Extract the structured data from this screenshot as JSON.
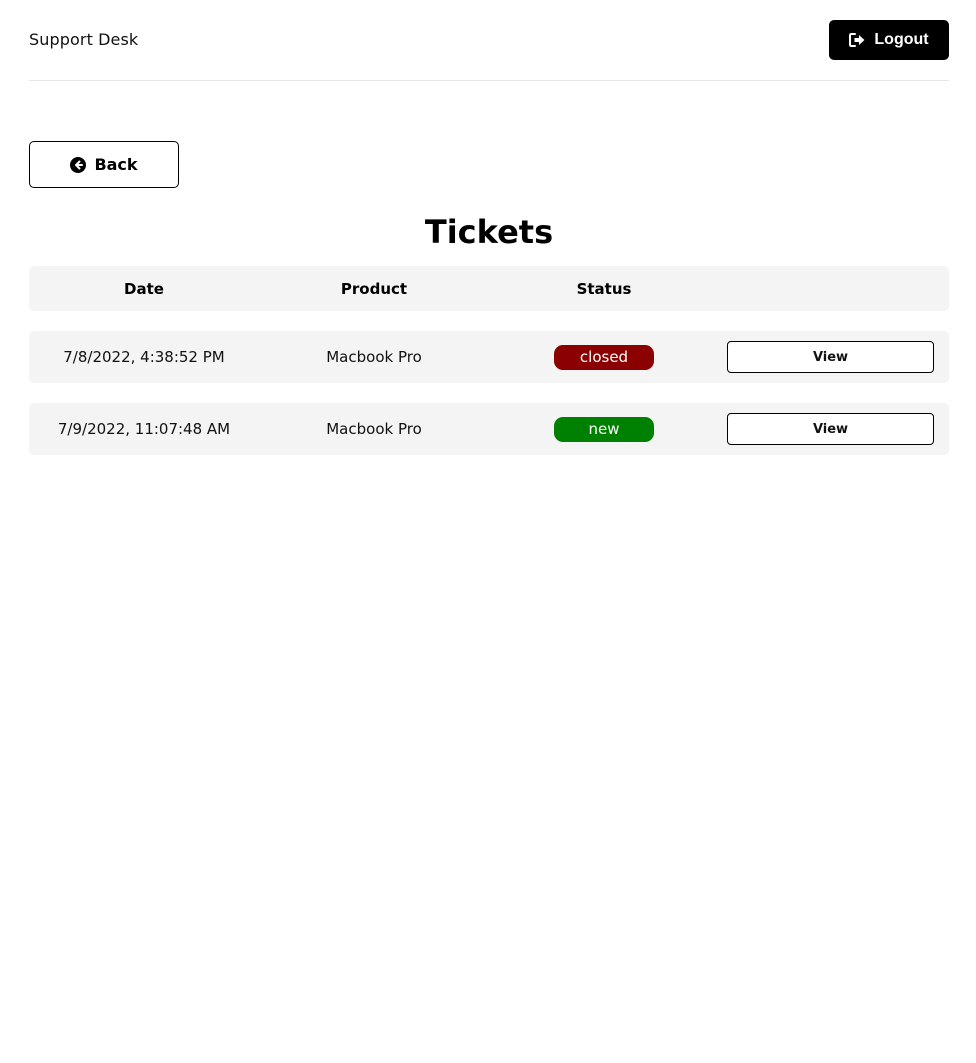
{
  "header": {
    "brand": "Support Desk",
    "logout_label": "Logout"
  },
  "back_label": "Back",
  "page_title": "Tickets",
  "table": {
    "columns": [
      "Date",
      "Product",
      "Status",
      ""
    ],
    "rows": [
      {
        "date": "7/8/2022, 4:38:52 PM",
        "product": "Macbook Pro",
        "status": "closed",
        "action": "View"
      },
      {
        "date": "7/9/2022, 11:07:48 AM",
        "product": "Macbook Pro",
        "status": "new",
        "action": "View"
      }
    ]
  },
  "colors": {
    "closed": "#8b0000",
    "new": "#008000",
    "primary": "#000000",
    "row_bg": "#f4f4f4"
  },
  "icons": {
    "logout": "sign-out-icon",
    "back": "arrow-circle-left-icon"
  }
}
